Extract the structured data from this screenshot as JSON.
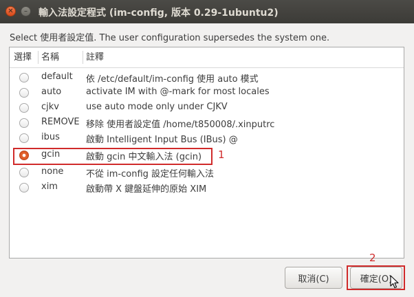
{
  "window": {
    "title": "輸入法設定程式 (im-config, 版本 0.29-1ubuntu2)",
    "close_glyph": "✕",
    "minimize_glyph": "–"
  },
  "prompt": "Select 使用者設定值. The user configuration supersedes the system one.",
  "table": {
    "columns": [
      "選擇",
      "名稱",
      "註釋"
    ],
    "rows": [
      {
        "name": "default",
        "description": "依 /etc/default/im-config 使用 auto 模式",
        "selected": false
      },
      {
        "name": "auto",
        "description": "activate IM with @-mark for most locales",
        "selected": false
      },
      {
        "name": "cjkv",
        "description": "use auto mode only under CJKV",
        "selected": false
      },
      {
        "name": "REMOVE",
        "description": "移除 使用者設定值 /home/t850008/.xinputrc",
        "selected": false
      },
      {
        "name": "ibus",
        "description": "啟動 Intelligent Input Bus (IBus) @",
        "selected": false
      },
      {
        "name": "gcin",
        "description": "啟動 gcin 中文輸入法 (gcin)",
        "selected": true
      },
      {
        "name": "none",
        "description": "不從 im-config 設定任何輸入法",
        "selected": false
      },
      {
        "name": "xim",
        "description": "啟動帶 X 鍵盤延伸的原始 XIM",
        "selected": false
      }
    ]
  },
  "annotations": {
    "step1": "1",
    "step2": "2",
    "color": "#d02a2a"
  },
  "buttons": {
    "cancel": "取消(C)",
    "ok": "確定(O)"
  },
  "colors": {
    "titlebar": "#3c3b37",
    "radio_selected": "#e5652f"
  }
}
